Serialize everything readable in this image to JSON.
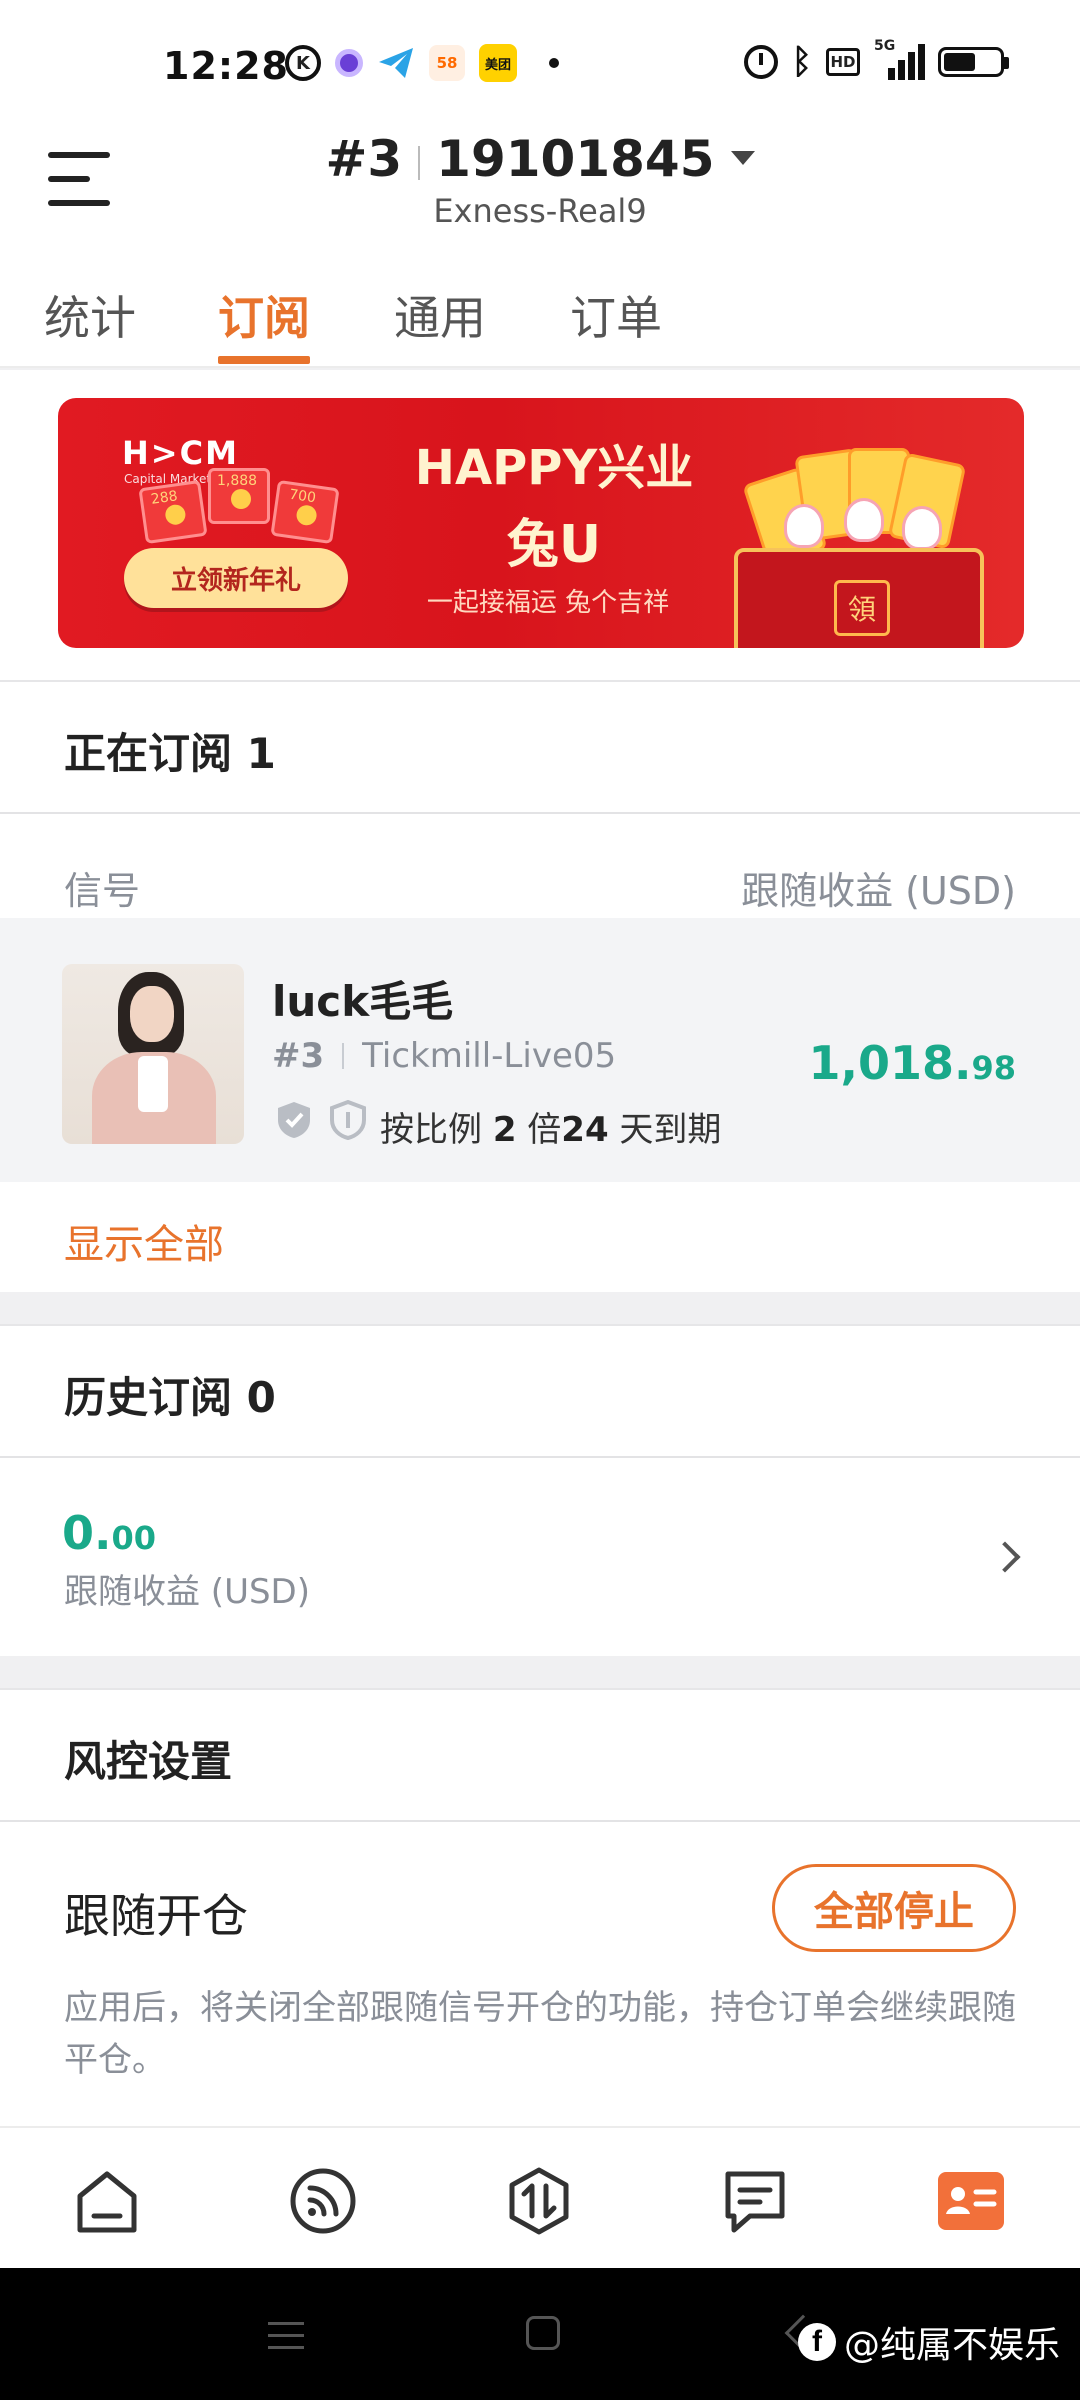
{
  "status_bar": {
    "time": "12:28",
    "left_icons": [
      "k-app-icon",
      "purple-app-icon",
      "telegram-icon",
      "58-app-icon",
      "meituan-app-icon",
      "notification-dot-icon"
    ],
    "app_58_label": "58",
    "meituan_label": "美团",
    "right_icons": [
      "alarm-icon",
      "bluetooth-icon",
      "hd-icon",
      "5g-signal-icon",
      "battery-icon"
    ],
    "hd_label": "HD",
    "network_label": "5G",
    "battery_level": 0.58
  },
  "header": {
    "account_prefix": "#3",
    "account_number": "19101845",
    "server": "Exness-Real9"
  },
  "tabs": [
    {
      "label": "统计",
      "active": false
    },
    {
      "label": "订阅",
      "active": true
    },
    {
      "label": "通用",
      "active": false
    },
    {
      "label": "订单",
      "active": false
    }
  ],
  "banner": {
    "logo": "H>CM",
    "logo_sub": "Capital Markets",
    "cta": "立领新年礼",
    "headline_1": "HAPPY兴业",
    "headline_2": "兔U",
    "slogan": "一起接福运 兔个吉祥",
    "box_char": "領",
    "redpack_values": [
      "288",
      "1,888",
      "700"
    ]
  },
  "current_subscriptions": {
    "title": "正在订阅 1",
    "col_signal": "信号",
    "col_profit": "跟随收益 (USD)",
    "items": [
      {
        "name": "luck毛毛",
        "rank": "#3",
        "server": "Tickmill-Live05",
        "terms_prefix": "按比例 ",
        "multiplier": "2",
        "terms_mid": " 倍",
        "days": "24",
        "terms_suffix": " 天到期",
        "profit_int": "1,018.",
        "profit_dec": "98"
      }
    ],
    "show_all": "显示全部"
  },
  "history_subscriptions": {
    "title": "历史订阅 0",
    "profit_int": "0.",
    "profit_dec": "00",
    "profit_label": "跟随收益 (USD)"
  },
  "risk": {
    "title": "风控设置",
    "follow_label": "跟随开仓",
    "stop_button": "全部停止",
    "description": "应用后，将关闭全部跟随信号开仓的功能，持仓订单会继续跟随平仓。"
  },
  "bottom_nav": [
    {
      "icon": "home-icon",
      "active": false
    },
    {
      "icon": "signal-feed-icon",
      "active": false
    },
    {
      "icon": "trade-icon",
      "active": false
    },
    {
      "icon": "message-icon",
      "active": false
    },
    {
      "icon": "account-card-icon",
      "active": true
    }
  ],
  "colors": {
    "accent": "#e8732c",
    "profit": "#1aa98a",
    "muted": "#8a8f98"
  },
  "watermark": {
    "text": "@纯属不娱乐"
  }
}
